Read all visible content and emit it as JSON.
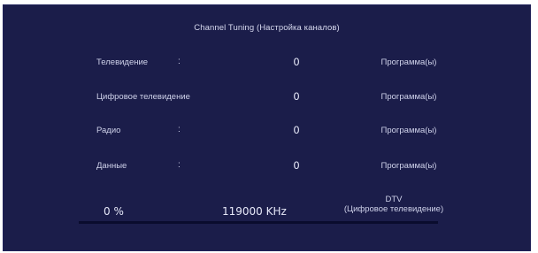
{
  "title": "Channel Tuning (Настройка каналов)",
  "rows": [
    {
      "label": "Телевидение",
      "colon": ":",
      "value": "0",
      "unit": "Программа(ы)"
    },
    {
      "label": "Цифровое телевидение",
      "colon": "",
      "value": "0",
      "unit": "Программа(ы)"
    },
    {
      "label": "Радио",
      "colon": ":",
      "value": "0",
      "unit": "Программа(ы)"
    },
    {
      "label": "Данные",
      "colon": ":",
      "value": "0",
      "unit": "Программа(ы)"
    }
  ],
  "progress": {
    "percent_text": "0 %",
    "fraction": 0,
    "frequency": "119000 KHz",
    "mode_line1": "DTV",
    "mode_line2": "(Цифровое телевидение)"
  },
  "colors": {
    "background": "#1b1d4a",
    "text": "#cfd2ea",
    "track": "#0a0c2e"
  }
}
